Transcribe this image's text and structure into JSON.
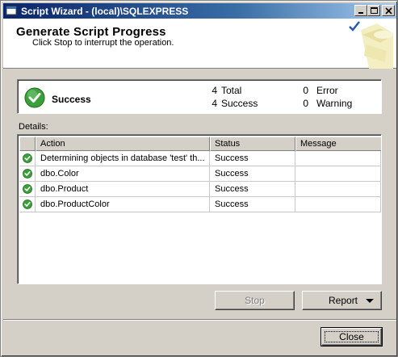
{
  "window": {
    "title": "Script Wizard - (local)\\SQLEXPRESS"
  },
  "header": {
    "title": "Generate Script Progress",
    "subtitle": "Click Stop to interrupt the operation."
  },
  "summary": {
    "status": "Success",
    "total_count": "4",
    "total_label": "Total",
    "success_count": "4",
    "success_label": "Success",
    "error_count": "0",
    "error_label": "Error",
    "warning_count": "0",
    "warning_label": "Warning"
  },
  "details": {
    "label": "Details:",
    "columns": [
      "Action",
      "Status",
      "Message"
    ],
    "rows": [
      {
        "action": "Determining objects in database 'test' th...",
        "status": "Success",
        "message": ""
      },
      {
        "action": "dbo.Color",
        "status": "Success",
        "message": ""
      },
      {
        "action": "dbo.Product",
        "status": "Success",
        "message": ""
      },
      {
        "action": "dbo.ProductColor",
        "status": "Success",
        "message": ""
      }
    ]
  },
  "buttons": {
    "stop": "Stop",
    "report": "Report",
    "close": "Close"
  },
  "icons": {
    "row_status": "success-check-icon",
    "summary_status": "success-check-icon"
  },
  "colors": {
    "success_green": "#2e9a2e",
    "title_bar": "#0a246a"
  }
}
